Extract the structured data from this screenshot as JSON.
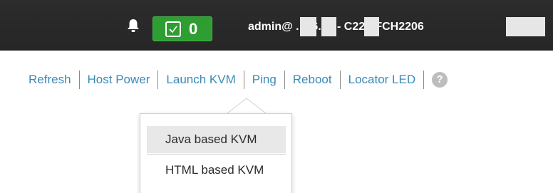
{
  "header": {
    "notification_icon": "bell-icon",
    "fault_badge": {
      "icon": "checkbox-icon",
      "count": "0",
      "color": "#2e9e32"
    },
    "user_host": "admin@  .  .76.21  - C220-FCH2206"
  },
  "actions": {
    "items": [
      {
        "label": "Refresh"
      },
      {
        "label": "Host Power"
      },
      {
        "label": "Launch KVM"
      },
      {
        "label": "Ping"
      },
      {
        "label": "Reboot"
      },
      {
        "label": "Locator LED"
      }
    ],
    "help_label": "?",
    "link_color": "#3a8ab8"
  },
  "kvm_menu": {
    "items": [
      {
        "label": "Java based KVM"
      },
      {
        "label": "HTML based KVM"
      }
    ]
  }
}
